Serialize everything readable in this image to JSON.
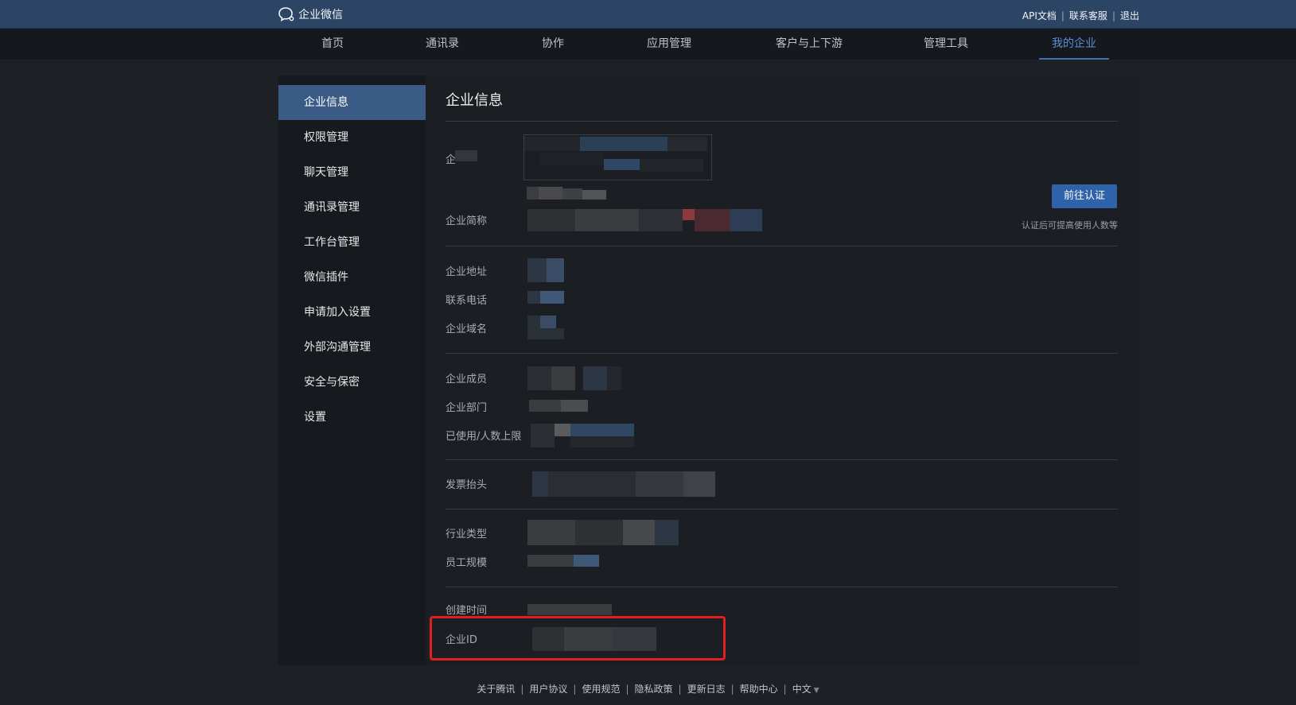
{
  "topbar": {
    "brand": "企业微信",
    "links": [
      "API文档",
      "联系客服",
      "退出"
    ]
  },
  "mainnav": {
    "tabs": [
      {
        "label": "首页",
        "active": false
      },
      {
        "label": "通讯录",
        "active": false
      },
      {
        "label": "协作",
        "active": false
      },
      {
        "label": "应用管理",
        "active": false
      },
      {
        "label": "客户与上下游",
        "active": false
      },
      {
        "label": "管理工具",
        "active": false
      },
      {
        "label": "我的企业",
        "active": true
      }
    ]
  },
  "sidebar": {
    "items": [
      {
        "label": "企业信息",
        "active": true
      },
      {
        "label": "权限管理",
        "active": false
      },
      {
        "label": "聊天管理",
        "active": false
      },
      {
        "label": "通讯录管理",
        "active": false
      },
      {
        "label": "工作台管理",
        "active": false
      },
      {
        "label": "微信插件",
        "active": false
      },
      {
        "label": "申请加入设置",
        "active": false
      },
      {
        "label": "外部沟通管理",
        "active": false
      },
      {
        "label": "安全与保密",
        "active": false
      },
      {
        "label": "设置",
        "active": false
      }
    ]
  },
  "content": {
    "title": "企业信息",
    "fields": {
      "company_name": "企",
      "short_name": "企业简称",
      "address": "企业地址",
      "phone": "联系电话",
      "domain": "企业域名",
      "members": "企业成员",
      "departments": "企业部门",
      "usage_limit": "已使用/人数上限",
      "invoice": "发票抬头",
      "industry": "行业类型",
      "staff_size": "员工规模",
      "created": "创建时间",
      "corp_id": "企业ID"
    },
    "verify_button": "前往认证",
    "verify_hint": "认证后可提高使用人数等"
  },
  "footer": {
    "links": [
      "关于腾讯",
      "用户协议",
      "使用规范",
      "隐私政策",
      "更新日志",
      "帮助中心"
    ],
    "language": "中文"
  },
  "colors": {
    "topbar": "#2d4565",
    "accent": "#3b5b87",
    "button": "#2f62a8",
    "highlight_border": "#e0201e"
  }
}
